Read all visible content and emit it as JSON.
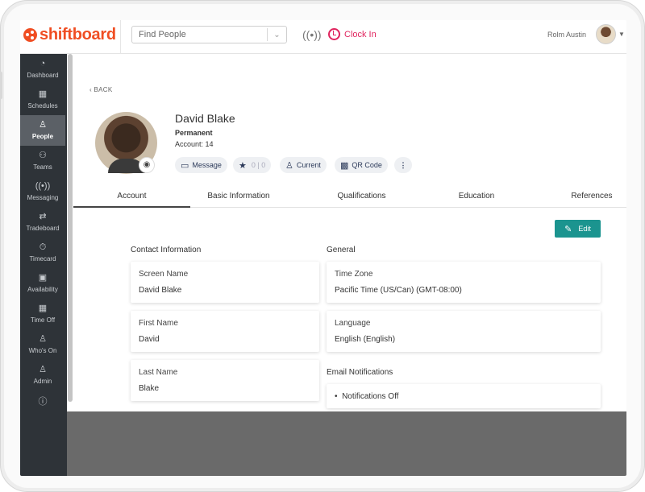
{
  "app": {
    "logo_text": "shiftboard",
    "brand_color": "#f04e23",
    "accent_color": "#1b948f"
  },
  "topbar": {
    "search_placeholder": "Find People",
    "clock_in_label": "Clock In",
    "user_name": "Rolm Austin"
  },
  "sidebar": {
    "items": [
      {
        "label": "Dashboard",
        "icon": "dashboard-icon"
      },
      {
        "label": "Schedules",
        "icon": "calendar-icon"
      },
      {
        "label": "People",
        "icon": "person-icon",
        "active": true
      },
      {
        "label": "Teams",
        "icon": "teams-icon"
      },
      {
        "label": "Messaging",
        "icon": "broadcast-icon"
      },
      {
        "label": "Tradeboard",
        "icon": "swap-icon"
      },
      {
        "label": "Timecard",
        "icon": "stopwatch-icon"
      },
      {
        "label": "Availability",
        "icon": "calendar-check-icon"
      },
      {
        "label": "Time Off",
        "icon": "calendar-icon"
      },
      {
        "label": "Who's On",
        "icon": "people-search-icon"
      },
      {
        "label": "Admin",
        "icon": "admin-icon"
      }
    ]
  },
  "profile": {
    "back_label": "BACK",
    "name": "David Blake",
    "type": "Permanent",
    "account": "Account: 14",
    "actions": {
      "message": "Message",
      "star_count_a": "0",
      "star_count_b": "0",
      "current": "Current",
      "qr": "QR Code"
    }
  },
  "tabs": [
    "Account",
    "Basic Information",
    "Qualifications",
    "Education",
    "References"
  ],
  "edit_label": "Edit",
  "contact": {
    "title": "Contact Information",
    "fields": [
      {
        "label": "Screen Name",
        "value": "David Blake"
      },
      {
        "label": "First Name",
        "value": "David"
      },
      {
        "label": "Last Name",
        "value": "Blake"
      }
    ]
  },
  "general": {
    "title": "General",
    "fields": [
      {
        "label": "Time Zone",
        "value": "Pacific Time (US/Can) (GMT-08:00)"
      },
      {
        "label": "Language",
        "value": "English (English)"
      }
    ]
  },
  "email_notifications": {
    "title": "Email Notifications",
    "items": [
      "Notifications Off"
    ]
  }
}
